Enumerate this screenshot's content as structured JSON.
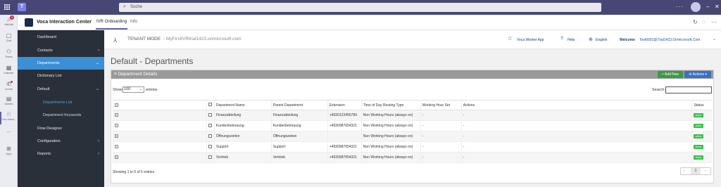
{
  "teams": {
    "search_placeholder": "Suche",
    "rail": [
      {
        "label": "Aktivität",
        "icon": "bell-icon",
        "badge": "4"
      },
      {
        "label": "Chat",
        "icon": "chat-icon"
      },
      {
        "label": "Teams",
        "icon": "teams-icon"
      },
      {
        "label": "Kalender",
        "icon": "calendar-icon"
      },
      {
        "label": "Anrufe",
        "icon": "phone-icon",
        "dot": true
      },
      {
        "label": "Dateien",
        "icon": "files-icon"
      },
      {
        "label": "Voca Intera...",
        "icon": "voca-app-icon",
        "active": true
      },
      {
        "label": "...",
        "icon": "more-icon"
      },
      {
        "label": "Apps",
        "icon": "apps-icon"
      }
    ]
  },
  "app": {
    "title": "Voca Interaction Center",
    "tabs": [
      "IVR Onboarding",
      "Info"
    ]
  },
  "sidebar": {
    "items": [
      {
        "label": "Dashboard"
      },
      {
        "label": "Contacts",
        "arrow": "›"
      },
      {
        "label": "Departments",
        "arrow": "⌄"
      },
      {
        "label": "Dictionary List"
      },
      {
        "label": "Default",
        "arrow": "⌄"
      },
      {
        "label": "Departments List"
      },
      {
        "label": "Department Keywords"
      },
      {
        "label": "Flow Designer"
      },
      {
        "label": "Configuration",
        "arrow": "›"
      },
      {
        "label": "Reports",
        "arrow": "›"
      }
    ]
  },
  "tenant": {
    "mode_label": "TENANT MODE",
    "domain": "- MyFirstIVRtrial1423.onmicrosoft.com",
    "worker_app": "Voca Worker App",
    "help": "Help",
    "language": "English",
    "welcome": "Welcome",
    "user_email": "Test0001@Trial1423.Onmicrosoft.Com"
  },
  "page": {
    "title": "Default - Departments",
    "panel_title": "≡ Department Details",
    "add_new": "+ Add New",
    "actions": "Actions",
    "show_label": "Show",
    "entries_value": "100",
    "entries_label": "entries",
    "search_label": "Search:",
    "showing": "Showing 1 to 5 of 5 entries",
    "page_number": "1"
  },
  "table": {
    "headers": [
      "",
      "",
      "Department Name",
      "Parent Department",
      "Extension",
      "Time of Day Routing Type",
      "Working Hour Set",
      "Actions",
      "Status"
    ],
    "rows": [
      {
        "name": "Finanzabteilung",
        "parent": "Finanzabteilung",
        "extension": "+4930123456789",
        "routing": "Non Working Hours (always on)",
        "hour_set": "-",
        "actions": "-",
        "status": "active"
      },
      {
        "name": "Kundenbetreuung",
        "parent": "Kundenbetreuung",
        "extension": "+4930987654321",
        "routing": "Non Working Hours (always on)",
        "hour_set": "-",
        "actions": "-",
        "status": "active"
      },
      {
        "name": "Öffnungszeiten",
        "parent": "Öffnungszeiten",
        "extension": "",
        "routing": "Non Working Hours (always on)",
        "hour_set": "-",
        "actions": "-",
        "status": "active"
      },
      {
        "name": "Support",
        "parent": "Support",
        "extension": "+4930987654321",
        "routing": "Non Working Hours (always on)",
        "hour_set": "-",
        "actions": "-",
        "status": "active"
      },
      {
        "name": "Vertrieb",
        "parent": "Vertrieb",
        "extension": "+4930987654321",
        "routing": "Non Working Hours (always on)",
        "hour_set": "-",
        "actions": "-",
        "status": "active"
      }
    ]
  }
}
